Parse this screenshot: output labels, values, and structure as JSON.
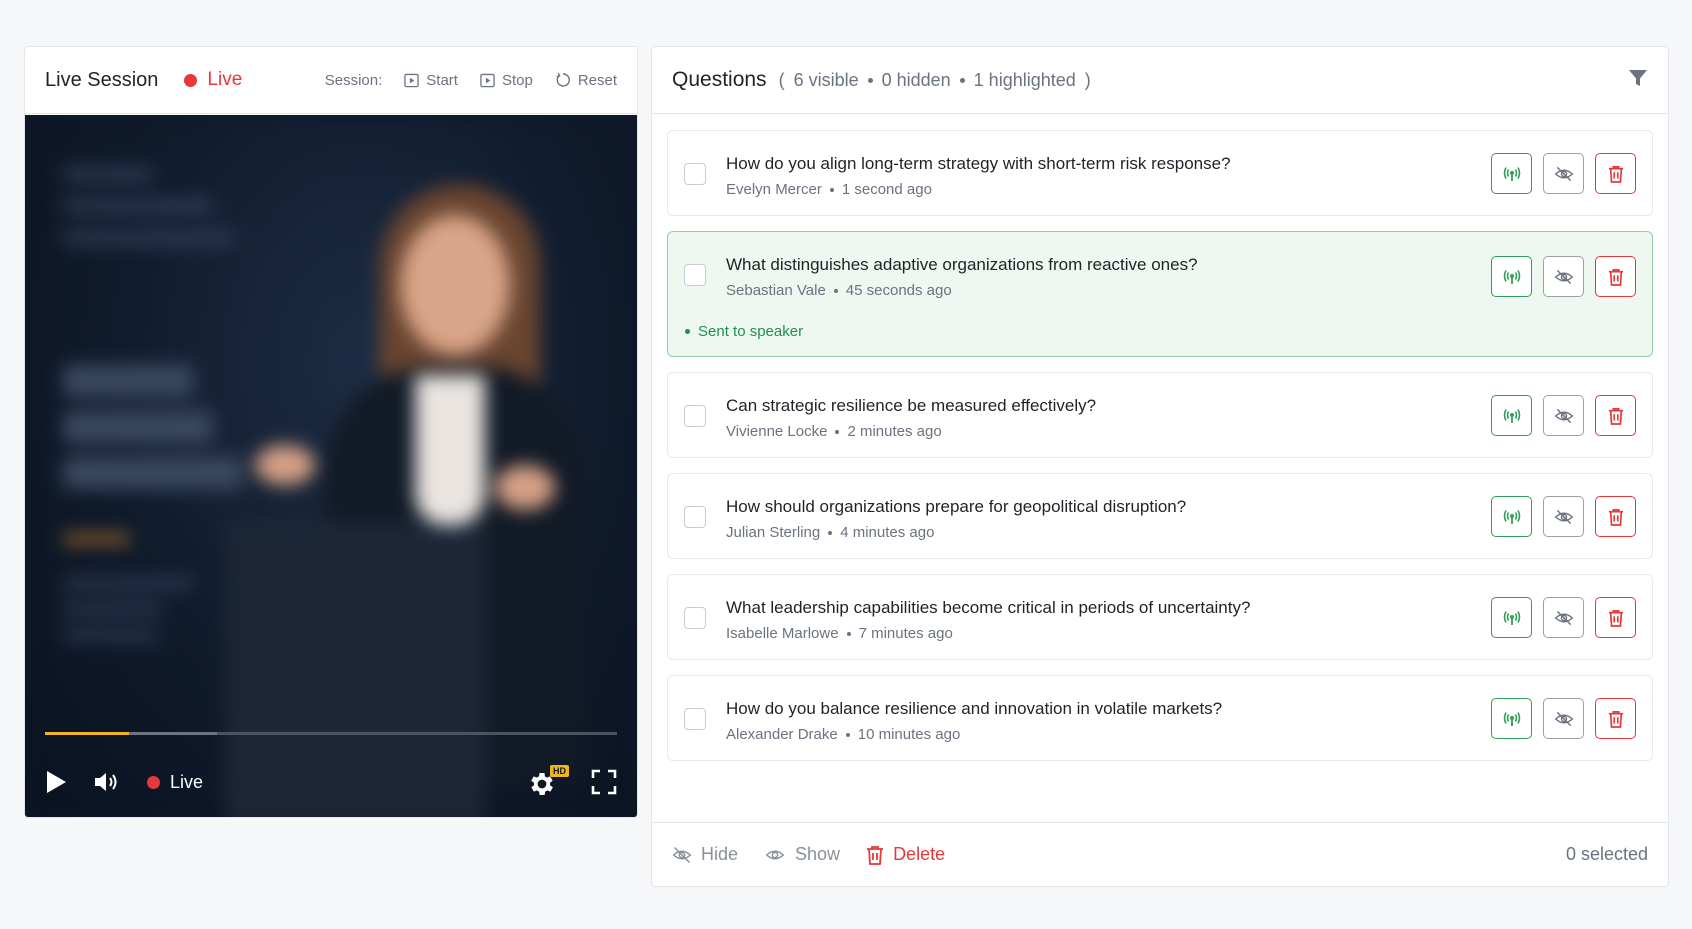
{
  "session": {
    "title": "Live Session",
    "status_label": "Live",
    "controls_label": "Session:",
    "start_label": "Start",
    "stop_label": "Stop",
    "reset_label": "Reset"
  },
  "player": {
    "progress_fraction": 0.147,
    "buffered_fraction": 0.3,
    "live_label": "Live",
    "quality_badge": "HD",
    "icons": [
      "play-icon",
      "volume-icon",
      "settings-icon",
      "fullscreen-icon"
    ]
  },
  "questions_panel": {
    "title": "Questions",
    "stats": {
      "open_paren": "(",
      "visible": "6 visible",
      "hidden": "0 hidden",
      "highlighted": "1 highlighted",
      "close_paren": ")"
    },
    "items": [
      {
        "text": "How do you align long-term strategy with short-term risk response?",
        "author": "Evelyn Mercer",
        "time": "1 second ago",
        "highlighted": false,
        "status": ""
      },
      {
        "text": "What distinguishes adaptive organizations from reactive ones?",
        "author": "Sebastian Vale",
        "time": "45 seconds ago",
        "highlighted": true,
        "status": "Sent to speaker"
      },
      {
        "text": "Can strategic resilience be measured effectively?",
        "author": "Vivienne Locke",
        "time": "2 minutes ago",
        "highlighted": false,
        "status": ""
      },
      {
        "text": "How should organizations prepare for geopolitical disruption?",
        "author": "Julian Sterling",
        "time": "4 minutes ago",
        "highlighted": false,
        "status": ""
      },
      {
        "text": "What leadership capabilities become critical in periods of uncertainty?",
        "author": "Isabelle Marlowe",
        "time": "7 minutes ago",
        "highlighted": false,
        "status": ""
      },
      {
        "text": "How do you balance resilience and innovation in volatile markets?",
        "author": "Alexander Drake",
        "time": "10 minutes ago",
        "highlighted": false,
        "status": ""
      }
    ],
    "footer": {
      "hide_label": "Hide",
      "show_label": "Show",
      "delete_label": "Delete",
      "selected_text": "0 selected"
    }
  },
  "colors": {
    "live_red": "#e5383b",
    "send_green": "#2f9e5a",
    "highlight_bg": "#eef8f1",
    "progress_yellow": "#f0b429"
  }
}
